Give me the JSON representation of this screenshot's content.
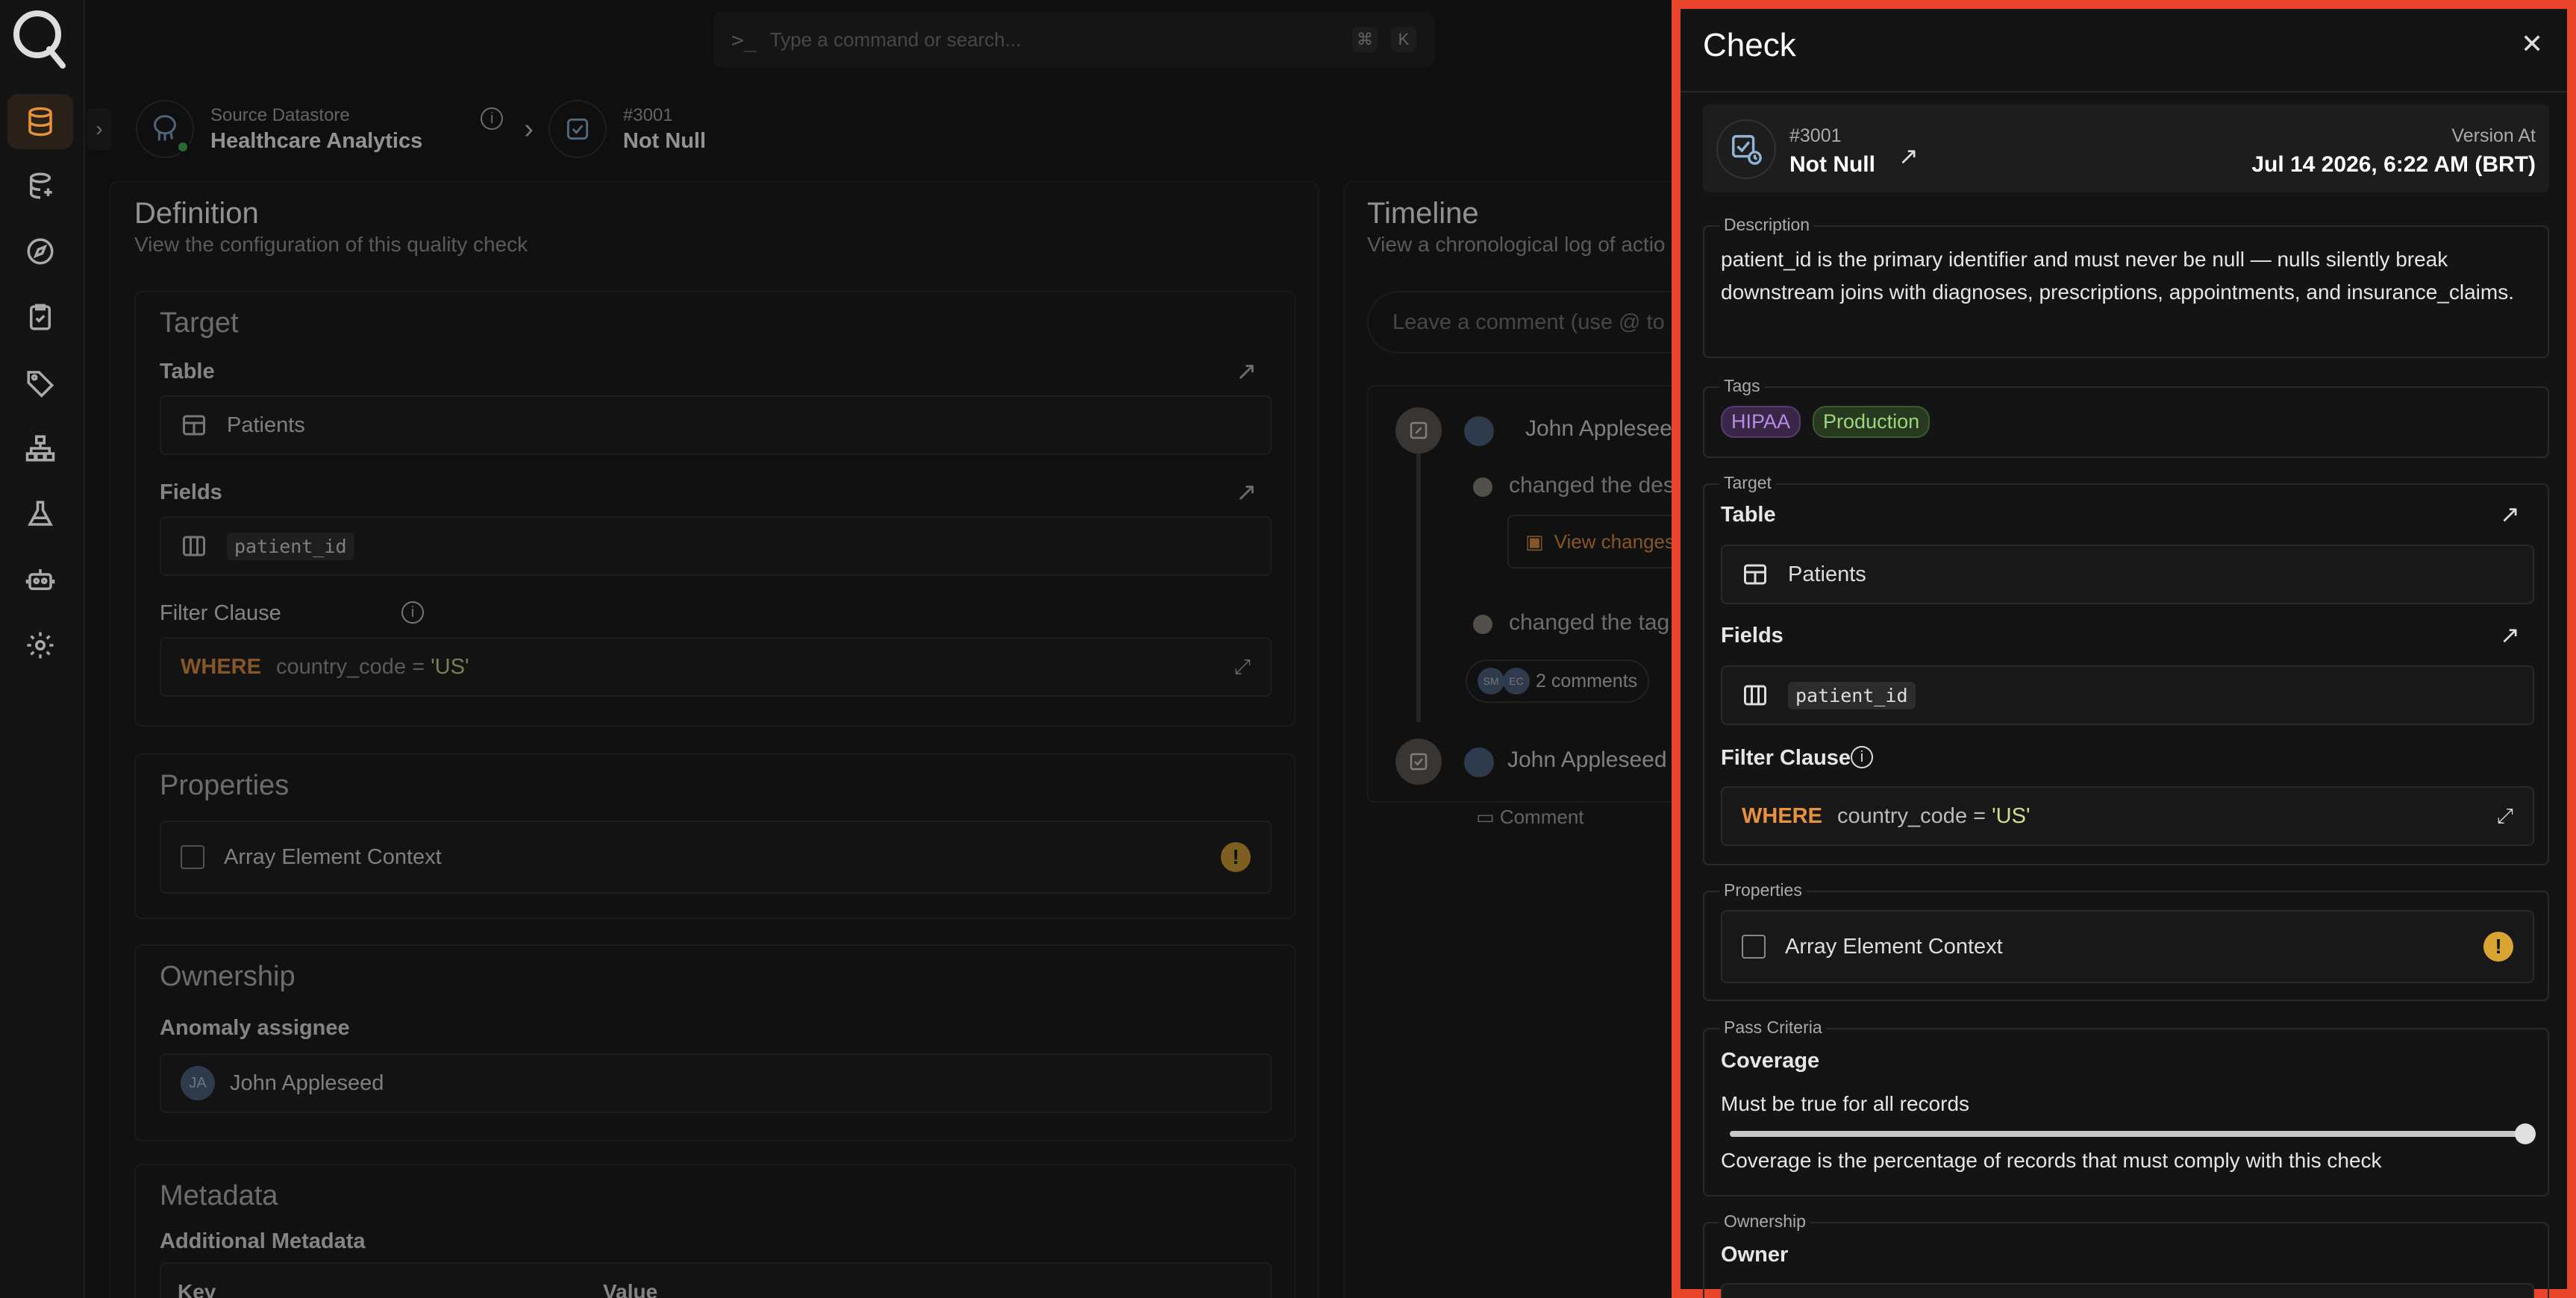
{
  "command_bar": {
    "placeholder": "Type a command or search...",
    "key_cmd": "⌘",
    "key_k": "K"
  },
  "breadcrumb": {
    "source_label": "Source Datastore",
    "source_name": "Healthcare Analytics",
    "check_id": "#3001",
    "check_name": "Not Null"
  },
  "definition": {
    "title": "Definition",
    "subtitle": "View the configuration of this quality check",
    "target_title": "Target",
    "table_label": "Table",
    "table_value": "Patients",
    "fields_label": "Fields",
    "field_chip": "patient_id",
    "filter_label": "Filter Clause",
    "filter_keyword": "WHERE",
    "filter_expr": "country_code = ",
    "filter_value": "'US'",
    "properties_title": "Properties",
    "property_item": "Array Element Context",
    "ownership_title": "Ownership",
    "assignee_label": "Anomaly assignee",
    "assignee_initials": "JA",
    "assignee_name": "John Appleseed",
    "metadata_title": "Metadata",
    "metadata_label": "Additional Metadata",
    "col_key": "Key",
    "col_value": "Value"
  },
  "timeline": {
    "title": "Timeline",
    "subtitle": "View a chronological log of actio",
    "comment_placeholder": "Leave a comment (use @ to m",
    "entry1_user": "John Applesee",
    "entry1_action1": "changed the des",
    "entry1_view_changes": "View changes",
    "entry1_action2": "changed the tag",
    "comments_count": "2 comments",
    "avatar_a": "SM",
    "avatar_b": "EC",
    "entry2_user": "John Appleseed",
    "comment_button": "Comment"
  },
  "drawer": {
    "title": "Check",
    "close": "✕",
    "check_id": "#3001",
    "check_name": "Not Null",
    "version_label": "Version At",
    "version_value": "Jul 14 2026, 6:22 AM (BRT)",
    "description_legend": "Description",
    "description_text": "patient_id is the primary identifier and must never be null — nulls silently break downstream joins with diagnoses, prescriptions, appointments, and insurance_claims.",
    "tags_legend": "Tags",
    "tags": [
      {
        "label": "HIPAA",
        "color": "#b88be6",
        "bg": "#3a2647"
      },
      {
        "label": "Production",
        "color": "#9fd67d",
        "bg": "#27391f"
      }
    ],
    "target_legend": "Target",
    "table_label": "Table",
    "table_value": "Patients",
    "fields_label": "Fields",
    "field_chip": "patient_id",
    "filter_label": "Filter Clause",
    "filter_keyword": "WHERE",
    "filter_expr": "country_code = ",
    "filter_value": "'US'",
    "properties_legend": "Properties",
    "property_item": "Array Element Context",
    "pass_legend": "Pass Criteria",
    "coverage_label": "Coverage",
    "coverage_rule": "Must be true for all records",
    "coverage_value": 1.0,
    "coverage_help": "Coverage is the percentage of records that must comply with this check",
    "ownership_legend": "Ownership",
    "owner_label": "Owner"
  },
  "colors": {
    "accent": "#e8923c",
    "drawer_border": "#e8442a",
    "status_online": "#3fb950"
  }
}
